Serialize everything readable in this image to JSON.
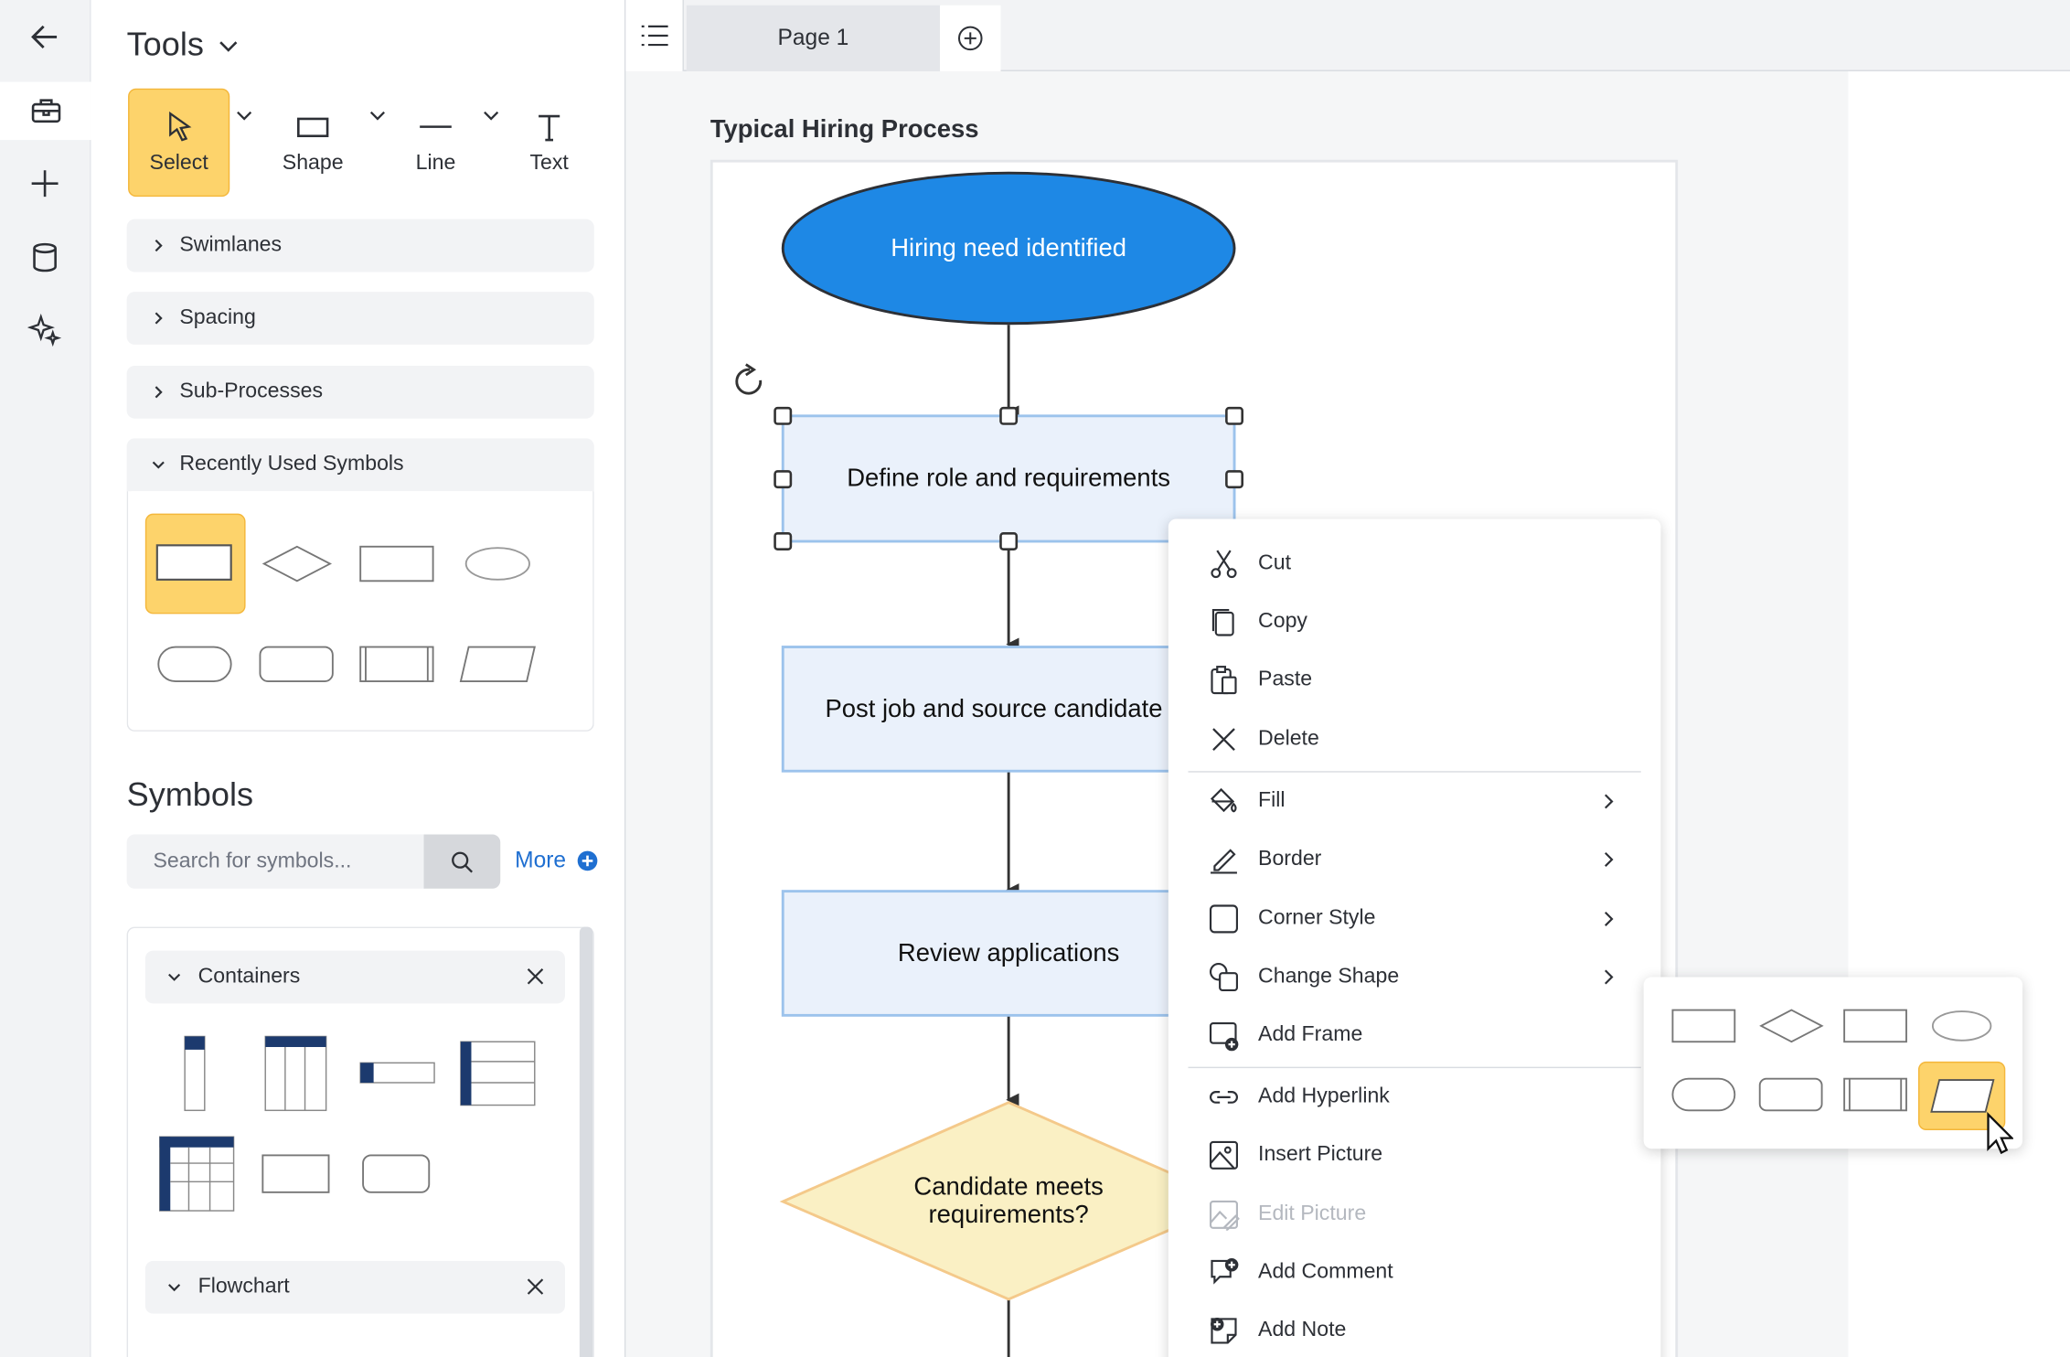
{
  "colors": {
    "accent_yellow": "#fdd36b",
    "start_node_blue": "#1e88e5",
    "process_fill": "#eaf1fb",
    "process_border": "#9cc3ec",
    "decision_fill": "#faf0c4",
    "decision_border": "#f4c98a",
    "link_blue": "#1f6fd1"
  },
  "rail": {
    "icons": [
      "back-arrow-icon",
      "toolbox-icon",
      "plus-icon",
      "database-icon",
      "sparkle-icon"
    ]
  },
  "tools": {
    "title": "Tools",
    "items": [
      {
        "label": "Select",
        "icon": "pointer-icon",
        "active": true
      },
      {
        "label": "Shape",
        "icon": "rectangle-icon"
      },
      {
        "label": "Line",
        "icon": "line-icon"
      },
      {
        "label": "Text",
        "icon": "text-icon"
      }
    ],
    "accordions": [
      "Swimlanes",
      "Spacing",
      "Sub-Processes",
      "Recently Used Symbols"
    ]
  },
  "symbols": {
    "title": "Symbols",
    "search_placeholder": "Search for symbols...",
    "more_label": "More",
    "libraries": [
      "Containers",
      "Flowchart"
    ]
  },
  "tabbar": {
    "page_label": "Page 1"
  },
  "diagram": {
    "title": "Typical Hiring Process",
    "nodes": {
      "start": "Hiring need identified",
      "step1": "Define role and requirements",
      "step2": "Post job and source candidate",
      "step3": "Review applications",
      "decision": "Candidate meets\nrequirements?"
    }
  },
  "context_menu": {
    "group1": [
      {
        "label": "Cut",
        "icon": "scissors-icon"
      },
      {
        "label": "Copy",
        "icon": "copy-icon"
      },
      {
        "label": "Paste",
        "icon": "paste-icon"
      },
      {
        "label": "Delete",
        "icon": "x-icon"
      }
    ],
    "group2": [
      {
        "label": "Fill",
        "icon": "paint-bucket-icon",
        "submenu": true
      },
      {
        "label": "Border",
        "icon": "pen-icon",
        "submenu": true
      },
      {
        "label": "Corner Style",
        "icon": "corner-square-icon",
        "submenu": true
      },
      {
        "label": "Change Shape",
        "icon": "change-shape-icon",
        "submenu": true
      },
      {
        "label": "Add Frame",
        "icon": "add-frame-icon"
      }
    ],
    "group3": [
      {
        "label": "Add Hyperlink",
        "icon": "link-icon"
      },
      {
        "label": "Insert Picture",
        "icon": "picture-icon"
      },
      {
        "label": "Edit Picture",
        "icon": "edit-picture-icon",
        "disabled": true
      },
      {
        "label": "Add Comment",
        "icon": "comment-icon"
      },
      {
        "label": "Add Note",
        "icon": "note-icon"
      }
    ]
  }
}
